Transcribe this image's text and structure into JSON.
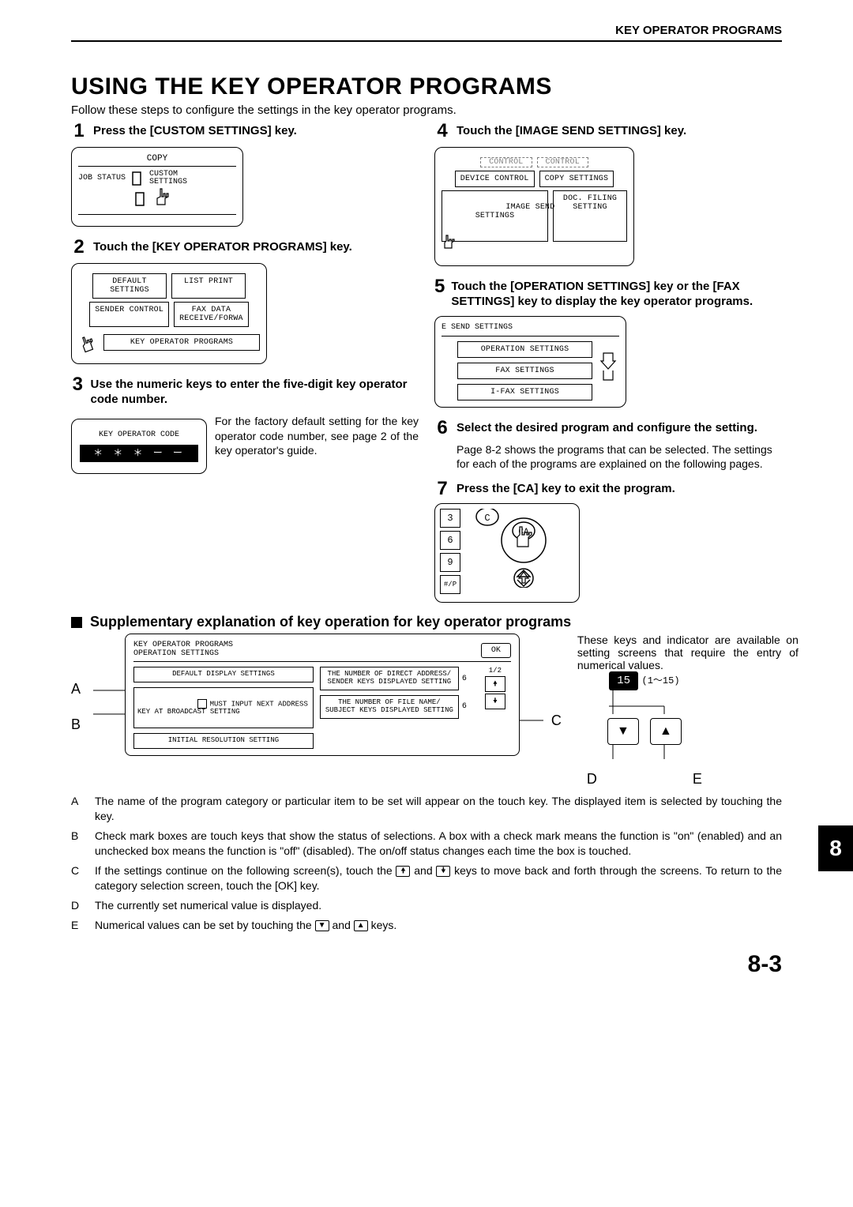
{
  "header": "KEY OPERATOR PROGRAMS",
  "title": "USING THE KEY OPERATOR PROGRAMS",
  "intro": "Follow these steps to configure the settings in the key operator programs.",
  "steps": {
    "s1": {
      "num": "1",
      "title": "Press the [CUSTOM SETTINGS] key."
    },
    "s2": {
      "num": "2",
      "title": "Touch the [KEY OPERATOR PROGRAMS] key."
    },
    "s3": {
      "num": "3",
      "title": "Use the numeric keys to enter the five-digit key operator code number.",
      "body": "For the factory default setting for the key operator code number, see page 2 of the key operator's guide."
    },
    "s4": {
      "num": "4",
      "title": "Touch the [IMAGE SEND SETTINGS] key."
    },
    "s5": {
      "num": "5",
      "title": "Touch the [OPERATION SETTINGS] key or the [FAX SETTINGS] key to display the key operator programs."
    },
    "s6": {
      "num": "6",
      "title": "Select the desired program and configure the setting.",
      "body": "Page 8-2 shows the programs that can be selected. The settings for each of the programs are explained on the following pages."
    },
    "s7": {
      "num": "7",
      "title": "Press the [CA] key to exit the program."
    }
  },
  "panel1": {
    "copy": "COPY",
    "job_status": "JOB STATUS",
    "custom_settings": "CUSTOM\nSETTINGS"
  },
  "panel2": {
    "btn1": "DEFAULT\nSETTINGS",
    "btn2": "LIST PRINT",
    "btn3": "SENDER CONTROL",
    "btn4": "FAX DATA\nRECEIVE/FORWA",
    "btn5": "KEY OPERATOR PROGRAMS"
  },
  "panel3": {
    "label": "KEY OPERATOR CODE",
    "value": "＊ ＊ ＊ ー ー"
  },
  "panel4": {
    "top1": "CONTROL",
    "top2": "CONTROL",
    "b1": "DEVICE CONTROL",
    "b2": "COPY SETTINGS",
    "b3": "IMAGE SEND\nSETTINGS",
    "b4": "DOC. FILING\nSETTING"
  },
  "panel5": {
    "title": "E SEND SETTINGS",
    "b1": "OPERATION SETTINGS",
    "b2": "FAX SETTINGS",
    "b3": "I-FAX SETTINGS"
  },
  "panel7": {
    "k3": "3",
    "k6": "6",
    "k9": "9",
    "kp": "#/P",
    "c": "C",
    "ca": "CA"
  },
  "supplementary": {
    "heading": "Supplementary explanation of key operation for key operator programs",
    "right_text": "These keys and indicator are available on setting screens that require the entry of numerical values.",
    "panel": {
      "title1": "KEY OPERATOR PROGRAMS",
      "title2": "OPERATION SETTINGS",
      "ok": "OK",
      "b1": "DEFAULT DISPLAY SETTINGS",
      "b2": "MUST INPUT NEXT ADDRESS\nKEY AT BROADCAST SETTING",
      "b3": "INITIAL RESOLUTION SETTING",
      "b4": "THE NUMBER OF DIRECT ADDRESS/\nSENDER KEYS DISPLAYED SETTING",
      "b5": "THE NUMBER OF FILE NAME/\nSUBJECT KEYS DISPLAYED SETTING",
      "v4": "6",
      "v5": "6",
      "page": "1/2"
    },
    "labels": {
      "A": "A",
      "B": "B",
      "C": "C",
      "D": "D",
      "E": "E"
    },
    "num": {
      "value": "15",
      "range": "(1～15)"
    },
    "defs": {
      "A": "The name of the program category or particular item to be set will appear on the touch key. The displayed item is selected by touching the key.",
      "B": "Check mark boxes are touch keys that show the status of selections. A box with a check mark means the function is \"on\" (enabled) and an unchecked box means the function is \"off\" (disabled). The on/off status changes each time the box is touched.",
      "C_pre": "If the settings continue on the following screen(s), touch the ",
      "C_mid": " and ",
      "C_post": " keys to move back and forth through the screens. To return to the category selection screen, touch the [OK] key.",
      "D": "The currently set numerical value is displayed.",
      "E_pre": "Numerical values can be set by touching the ",
      "E_mid": " and ",
      "E_post": " keys."
    }
  },
  "chapter_tab": "8",
  "page_number": "8-3"
}
